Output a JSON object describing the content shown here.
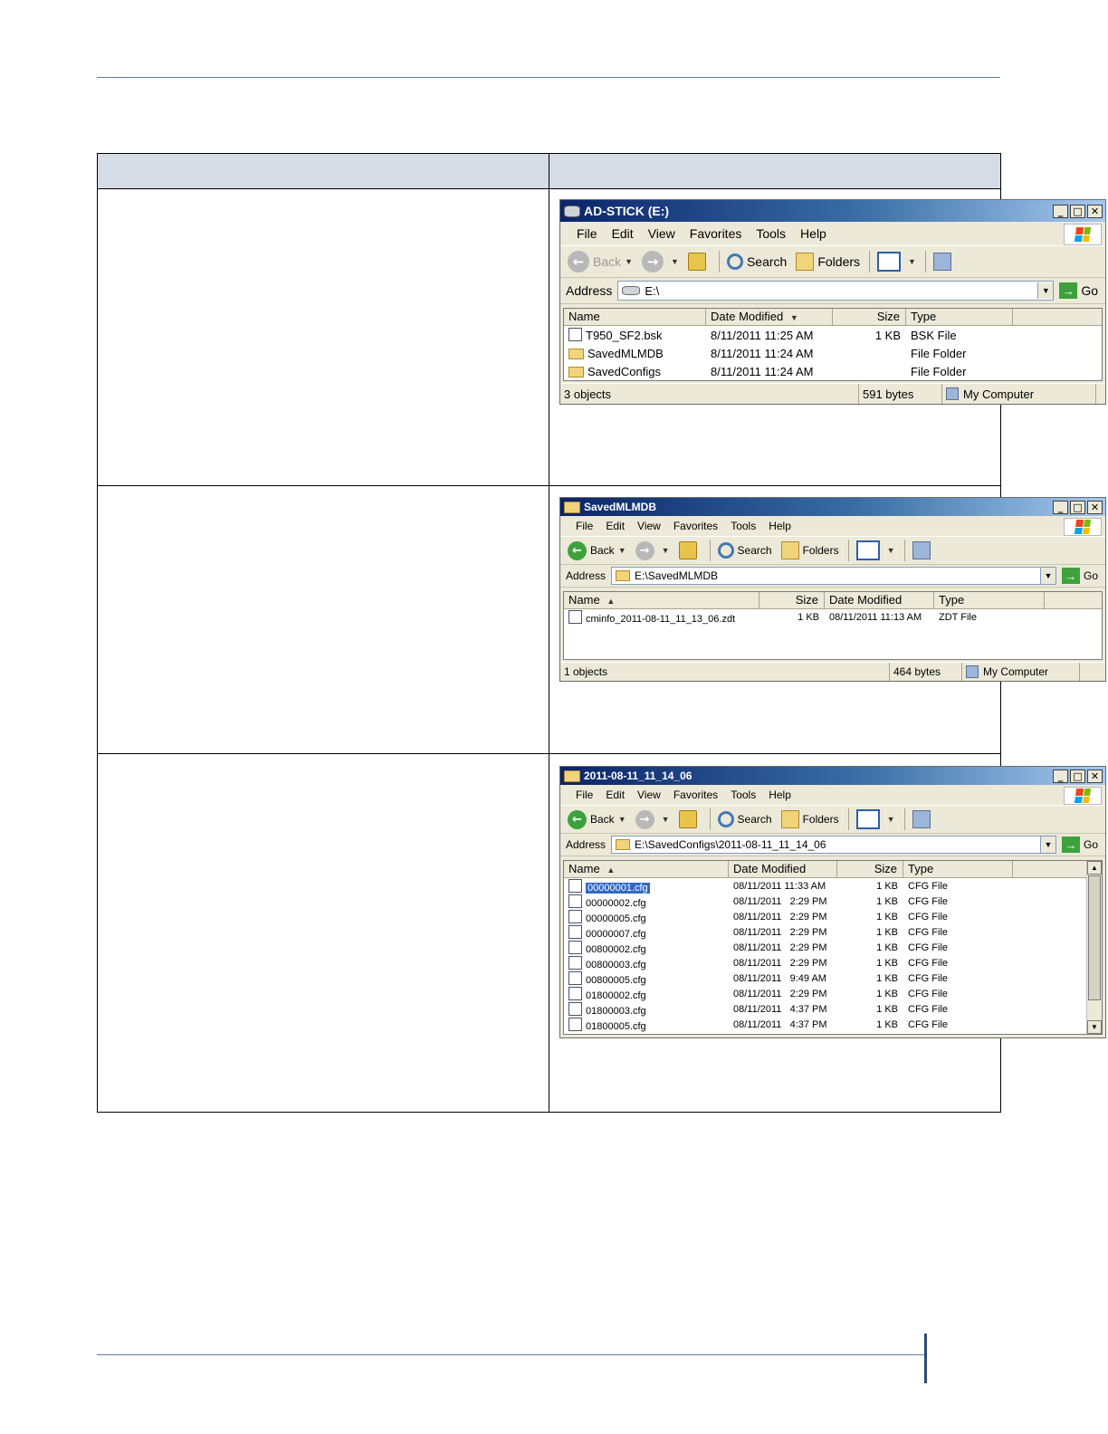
{
  "windows": [
    {
      "title": "AD-STICK (E:)",
      "menu": [
        "File",
        "Edit",
        "View",
        "Favorites",
        "Tools",
        "Help"
      ],
      "toolbar": {
        "back": "Back",
        "search": "Search",
        "folders": "Folders"
      },
      "address_label": "Address",
      "address": "E:\\",
      "go": "Go",
      "columns": [
        "Name",
        "Date Modified",
        "Size",
        "Type"
      ],
      "rows": [
        {
          "name": "T950_SF2.bsk",
          "date": "8/11/2011 11:25 AM",
          "size": "1 KB",
          "type": "BSK File"
        },
        {
          "name": "SavedMLMDB",
          "date": "8/11/2011 11:24 AM",
          "size": "",
          "type": "File Folder"
        },
        {
          "name": "SavedConfigs",
          "date": "8/11/2011 11:24 AM",
          "size": "",
          "type": "File Folder"
        }
      ],
      "status": {
        "objects": "3 objects",
        "bytes": "591 bytes",
        "location": "My Computer"
      }
    },
    {
      "title": "SavedMLMDB",
      "menu": [
        "File",
        "Edit",
        "View",
        "Favorites",
        "Tools",
        "Help"
      ],
      "toolbar": {
        "back": "Back",
        "search": "Search",
        "folders": "Folders"
      },
      "address_label": "Address",
      "address": "E:\\SavedMLMDB",
      "go": "Go",
      "columns": [
        "Name",
        "Size",
        "Date Modified",
        "Type"
      ],
      "rows": [
        {
          "name": "cminfo_2011-08-11_11_13_06.zdt",
          "size": "1 KB",
          "date": "08/11/2011 11:13 AM",
          "type": "ZDT File"
        }
      ],
      "status": {
        "objects": "1 objects",
        "bytes": "464 bytes",
        "location": "My Computer"
      }
    },
    {
      "title": "2011-08-11_11_14_06",
      "menu": [
        "File",
        "Edit",
        "View",
        "Favorites",
        "Tools",
        "Help"
      ],
      "toolbar": {
        "back": "Back",
        "search": "Search",
        "folders": "Folders"
      },
      "address_label": "Address",
      "address": "E:\\SavedConfigs\\2011-08-11_11_14_06",
      "go": "Go",
      "columns": [
        "Name",
        "Date Modified",
        "Size",
        "Type"
      ],
      "rows": [
        {
          "name": "00000001.cfg",
          "date": "08/11/2011 11:33 AM",
          "size": "1 KB",
          "type": "CFG File"
        },
        {
          "name": "00000002.cfg",
          "date": "08/11/2011   2:29 PM",
          "size": "1 KB",
          "type": "CFG File"
        },
        {
          "name": "00000005.cfg",
          "date": "08/11/2011   2:29 PM",
          "size": "1 KB",
          "type": "CFG File"
        },
        {
          "name": "00000007.cfg",
          "date": "08/11/2011   2:29 PM",
          "size": "1 KB",
          "type": "CFG File"
        },
        {
          "name": "00800002.cfg",
          "date": "08/11/2011   2:29 PM",
          "size": "1 KB",
          "type": "CFG File"
        },
        {
          "name": "00800003.cfg",
          "date": "08/11/2011   2:29 PM",
          "size": "1 KB",
          "type": "CFG File"
        },
        {
          "name": "00800005.cfg",
          "date": "08/11/2011   9:49 AM",
          "size": "1 KB",
          "type": "CFG File"
        },
        {
          "name": "01800002.cfg",
          "date": "08/11/2011   2:29 PM",
          "size": "1 KB",
          "type": "CFG File"
        },
        {
          "name": "01800003.cfg",
          "date": "08/11/2011   4:37 PM",
          "size": "1 KB",
          "type": "CFG File"
        },
        {
          "name": "01800005.cfg",
          "date": "08/11/2011   4:37 PM",
          "size": "1 KB",
          "type": "CFG File"
        }
      ]
    }
  ]
}
